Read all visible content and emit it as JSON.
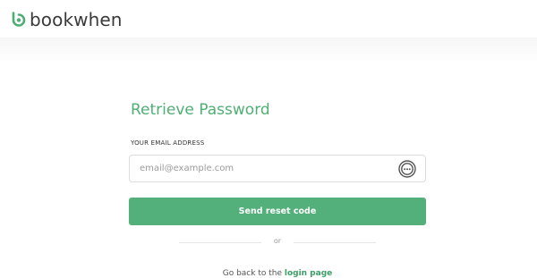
{
  "brand": {
    "name": "bookwhen",
    "accent": "#4fae74"
  },
  "form": {
    "title": "Retrieve Password",
    "email_label": "YOUR EMAIL ADDRESS",
    "email_placeholder": "email@example.com",
    "email_value": "",
    "password_manager_icon": "password-manager-icon",
    "submit_label": "Send reset code",
    "divider_text": "or",
    "back_prefix": "Go back to the ",
    "back_link": "login page"
  },
  "colors": {
    "button": "#53b07a",
    "title": "#4fae74",
    "link": "#3e9e67"
  }
}
